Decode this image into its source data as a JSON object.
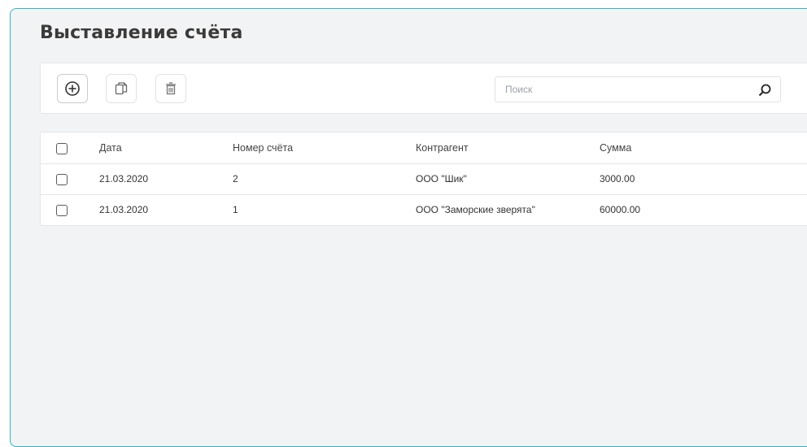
{
  "page": {
    "title": "Выставление счёта"
  },
  "toolbar": {
    "buttons": [
      {
        "name": "add",
        "icon": "plus-circle-icon"
      },
      {
        "name": "copy",
        "icon": "copy-icon"
      },
      {
        "name": "delete",
        "icon": "trash-icon"
      }
    ],
    "search": {
      "placeholder": "Поиск",
      "value": "",
      "icon": "search-icon"
    }
  },
  "table": {
    "columns": [
      "Дата",
      "Номер счёта",
      "Контрагент",
      "Сумма"
    ],
    "rows": [
      {
        "date": "21.03.2020",
        "number": "2",
        "counterparty": "ООО \"Шик\"",
        "amount": "3000.00",
        "checked": false
      },
      {
        "date": "21.03.2020",
        "number": "1",
        "counterparty": "ООО \"Заморские зверята\"",
        "amount": "60000.00",
        "checked": false
      }
    ]
  },
  "colors": {
    "accent_border": "#2fb6c4",
    "background": "#f2f3f5"
  }
}
